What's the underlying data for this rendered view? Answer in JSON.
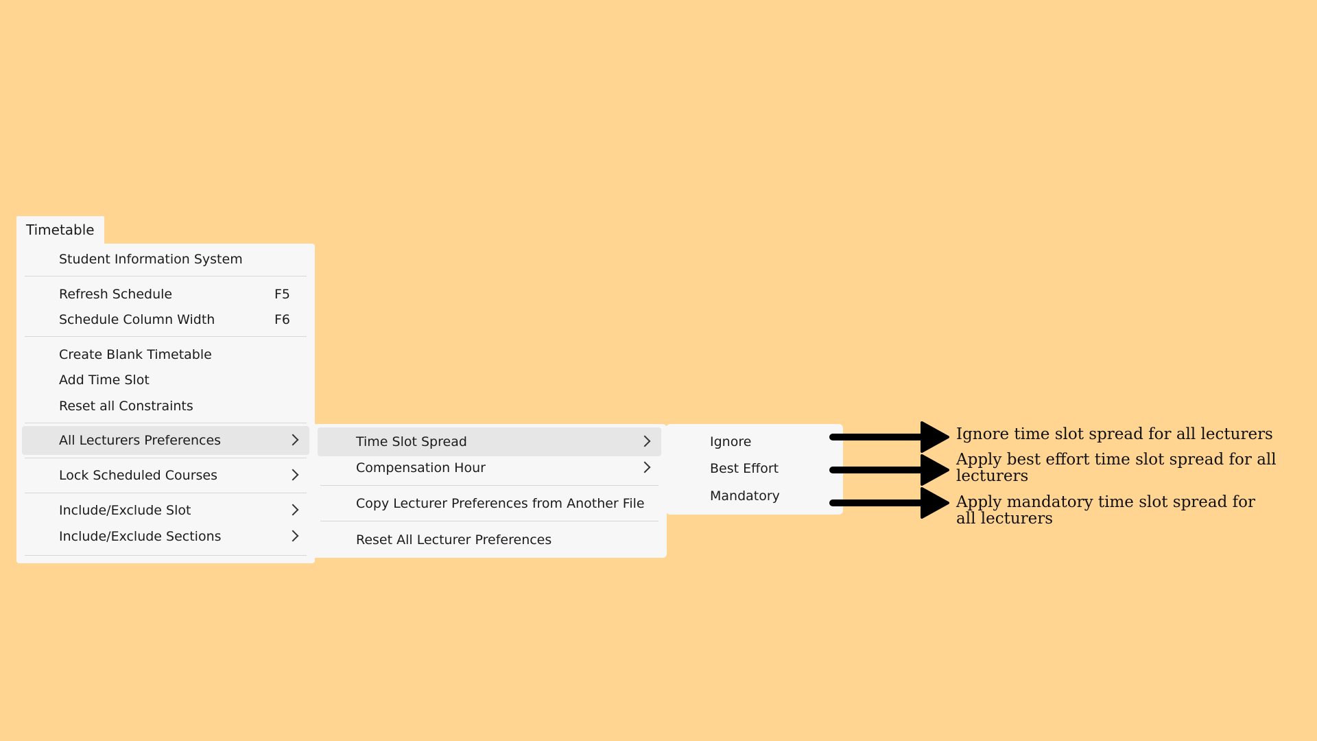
{
  "menubar": {
    "label": "Timetable"
  },
  "main_menu": {
    "student_info": {
      "label": "Student Information System"
    },
    "refresh": {
      "label": "Refresh Schedule",
      "shortcut": "F5"
    },
    "column_width": {
      "label": "Schedule Column Width",
      "shortcut": "F6"
    },
    "create_blank": {
      "label": "Create Blank Timetable"
    },
    "add_slot": {
      "label": "Add Time Slot"
    },
    "reset_constraints": {
      "label": "Reset all Constraints"
    },
    "lecturers_prefs": {
      "label": "All Lecturers Preferences"
    },
    "lock_courses": {
      "label": "Lock Scheduled Courses"
    },
    "incl_slot": {
      "label": "Include/Exclude Slot"
    },
    "incl_sections": {
      "label": "Include/Exclude Sections"
    }
  },
  "sub_menu": {
    "time_slot_spread": {
      "label": "Time Slot Spread"
    },
    "compensation": {
      "label": "Compensation Hour"
    },
    "copy_prefs": {
      "label": "Copy Lecturer Preferences from Another File"
    },
    "reset_prefs": {
      "label": "Reset All Lecturer Preferences"
    }
  },
  "sub_sub_menu": {
    "ignore": {
      "label": "Ignore"
    },
    "best_effort": {
      "label": "Best Effort"
    },
    "mandatory": {
      "label": "Mandatory"
    }
  },
  "annotations": {
    "ignore": "Ignore time slot spread for all lecturers",
    "best_effort": "Apply best effort time slot spread for all lecturers",
    "mandatory": "Apply mandatory time slot spread for all lecturers"
  },
  "colors": {
    "background": "#FFD591",
    "menu": "#f7f7f7",
    "highlight": "#e6e6e6",
    "arrow": "#000000"
  }
}
